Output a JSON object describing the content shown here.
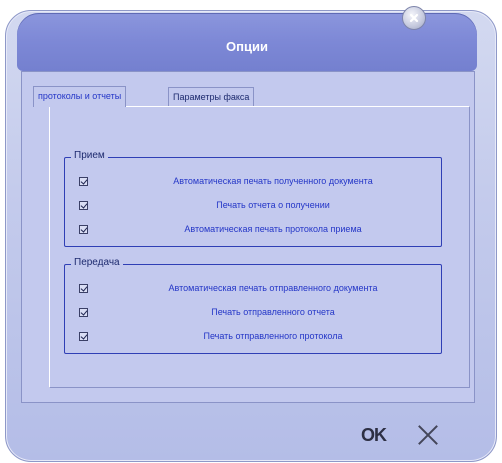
{
  "window": {
    "title": "Опции"
  },
  "tabs": [
    {
      "label": "протоколы и отчеты"
    },
    {
      "label": "Параметры факса"
    }
  ],
  "receive_group": {
    "legend": "Прием",
    "items": [
      {
        "label": "Автоматическая печать полученного документа",
        "checked": true
      },
      {
        "label": "Печать отчета о получении",
        "checked": true
      },
      {
        "label": "Автоматическая печать протокола приема",
        "checked": true
      }
    ]
  },
  "send_group": {
    "legend": "Передача",
    "items": [
      {
        "label": "Автоматическая печать отправленного документа",
        "checked": true
      },
      {
        "label": "Печать отправленного отчета",
        "checked": true
      },
      {
        "label": "Печать отправленного протокола",
        "checked": true
      }
    ]
  },
  "footer": {
    "ok_label": "OK"
  },
  "icons": {
    "close": "close-icon",
    "cancel": "cancel-x-icon"
  },
  "colors": {
    "title_bar": "#7d88d6",
    "label_text": "#2436c7",
    "group_border": "#2f3fb5"
  }
}
